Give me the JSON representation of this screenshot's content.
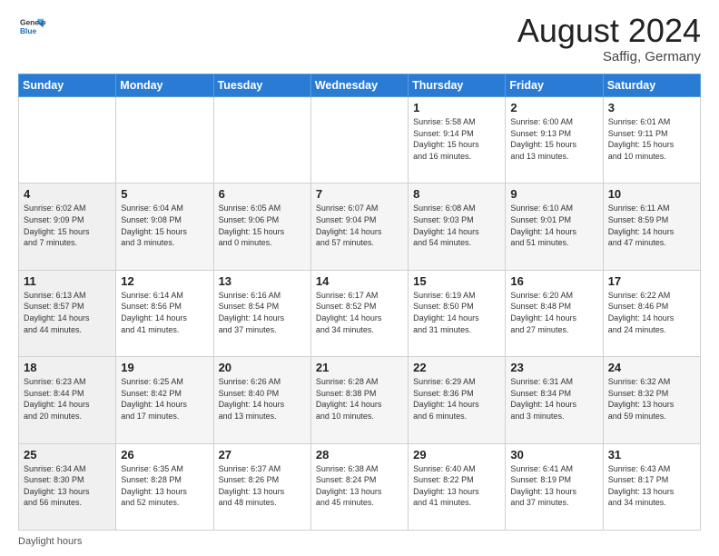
{
  "header": {
    "logo_line1": "General",
    "logo_line2": "Blue",
    "month_title": "August 2024",
    "location": "Saffig, Germany"
  },
  "days_of_week": [
    "Sunday",
    "Monday",
    "Tuesday",
    "Wednesday",
    "Thursday",
    "Friday",
    "Saturday"
  ],
  "weeks": [
    [
      {
        "day": "",
        "info": ""
      },
      {
        "day": "",
        "info": ""
      },
      {
        "day": "",
        "info": ""
      },
      {
        "day": "",
        "info": ""
      },
      {
        "day": "1",
        "info": "Sunrise: 5:58 AM\nSunset: 9:14 PM\nDaylight: 15 hours\nand 16 minutes."
      },
      {
        "day": "2",
        "info": "Sunrise: 6:00 AM\nSunset: 9:13 PM\nDaylight: 15 hours\nand 13 minutes."
      },
      {
        "day": "3",
        "info": "Sunrise: 6:01 AM\nSunset: 9:11 PM\nDaylight: 15 hours\nand 10 minutes."
      }
    ],
    [
      {
        "day": "4",
        "info": "Sunrise: 6:02 AM\nSunset: 9:09 PM\nDaylight: 15 hours\nand 7 minutes."
      },
      {
        "day": "5",
        "info": "Sunrise: 6:04 AM\nSunset: 9:08 PM\nDaylight: 15 hours\nand 3 minutes."
      },
      {
        "day": "6",
        "info": "Sunrise: 6:05 AM\nSunset: 9:06 PM\nDaylight: 15 hours\nand 0 minutes."
      },
      {
        "day": "7",
        "info": "Sunrise: 6:07 AM\nSunset: 9:04 PM\nDaylight: 14 hours\nand 57 minutes."
      },
      {
        "day": "8",
        "info": "Sunrise: 6:08 AM\nSunset: 9:03 PM\nDaylight: 14 hours\nand 54 minutes."
      },
      {
        "day": "9",
        "info": "Sunrise: 6:10 AM\nSunset: 9:01 PM\nDaylight: 14 hours\nand 51 minutes."
      },
      {
        "day": "10",
        "info": "Sunrise: 6:11 AM\nSunset: 8:59 PM\nDaylight: 14 hours\nand 47 minutes."
      }
    ],
    [
      {
        "day": "11",
        "info": "Sunrise: 6:13 AM\nSunset: 8:57 PM\nDaylight: 14 hours\nand 44 minutes."
      },
      {
        "day": "12",
        "info": "Sunrise: 6:14 AM\nSunset: 8:56 PM\nDaylight: 14 hours\nand 41 minutes."
      },
      {
        "day": "13",
        "info": "Sunrise: 6:16 AM\nSunset: 8:54 PM\nDaylight: 14 hours\nand 37 minutes."
      },
      {
        "day": "14",
        "info": "Sunrise: 6:17 AM\nSunset: 8:52 PM\nDaylight: 14 hours\nand 34 minutes."
      },
      {
        "day": "15",
        "info": "Sunrise: 6:19 AM\nSunset: 8:50 PM\nDaylight: 14 hours\nand 31 minutes."
      },
      {
        "day": "16",
        "info": "Sunrise: 6:20 AM\nSunset: 8:48 PM\nDaylight: 14 hours\nand 27 minutes."
      },
      {
        "day": "17",
        "info": "Sunrise: 6:22 AM\nSunset: 8:46 PM\nDaylight: 14 hours\nand 24 minutes."
      }
    ],
    [
      {
        "day": "18",
        "info": "Sunrise: 6:23 AM\nSunset: 8:44 PM\nDaylight: 14 hours\nand 20 minutes."
      },
      {
        "day": "19",
        "info": "Sunrise: 6:25 AM\nSunset: 8:42 PM\nDaylight: 14 hours\nand 17 minutes."
      },
      {
        "day": "20",
        "info": "Sunrise: 6:26 AM\nSunset: 8:40 PM\nDaylight: 14 hours\nand 13 minutes."
      },
      {
        "day": "21",
        "info": "Sunrise: 6:28 AM\nSunset: 8:38 PM\nDaylight: 14 hours\nand 10 minutes."
      },
      {
        "day": "22",
        "info": "Sunrise: 6:29 AM\nSunset: 8:36 PM\nDaylight: 14 hours\nand 6 minutes."
      },
      {
        "day": "23",
        "info": "Sunrise: 6:31 AM\nSunset: 8:34 PM\nDaylight: 14 hours\nand 3 minutes."
      },
      {
        "day": "24",
        "info": "Sunrise: 6:32 AM\nSunset: 8:32 PM\nDaylight: 13 hours\nand 59 minutes."
      }
    ],
    [
      {
        "day": "25",
        "info": "Sunrise: 6:34 AM\nSunset: 8:30 PM\nDaylight: 13 hours\nand 56 minutes."
      },
      {
        "day": "26",
        "info": "Sunrise: 6:35 AM\nSunset: 8:28 PM\nDaylight: 13 hours\nand 52 minutes."
      },
      {
        "day": "27",
        "info": "Sunrise: 6:37 AM\nSunset: 8:26 PM\nDaylight: 13 hours\nand 48 minutes."
      },
      {
        "day": "28",
        "info": "Sunrise: 6:38 AM\nSunset: 8:24 PM\nDaylight: 13 hours\nand 45 minutes."
      },
      {
        "day": "29",
        "info": "Sunrise: 6:40 AM\nSunset: 8:22 PM\nDaylight: 13 hours\nand 41 minutes."
      },
      {
        "day": "30",
        "info": "Sunrise: 6:41 AM\nSunset: 8:19 PM\nDaylight: 13 hours\nand 37 minutes."
      },
      {
        "day": "31",
        "info": "Sunrise: 6:43 AM\nSunset: 8:17 PM\nDaylight: 13 hours\nand 34 minutes."
      }
    ]
  ],
  "footer": {
    "note": "Daylight hours"
  }
}
